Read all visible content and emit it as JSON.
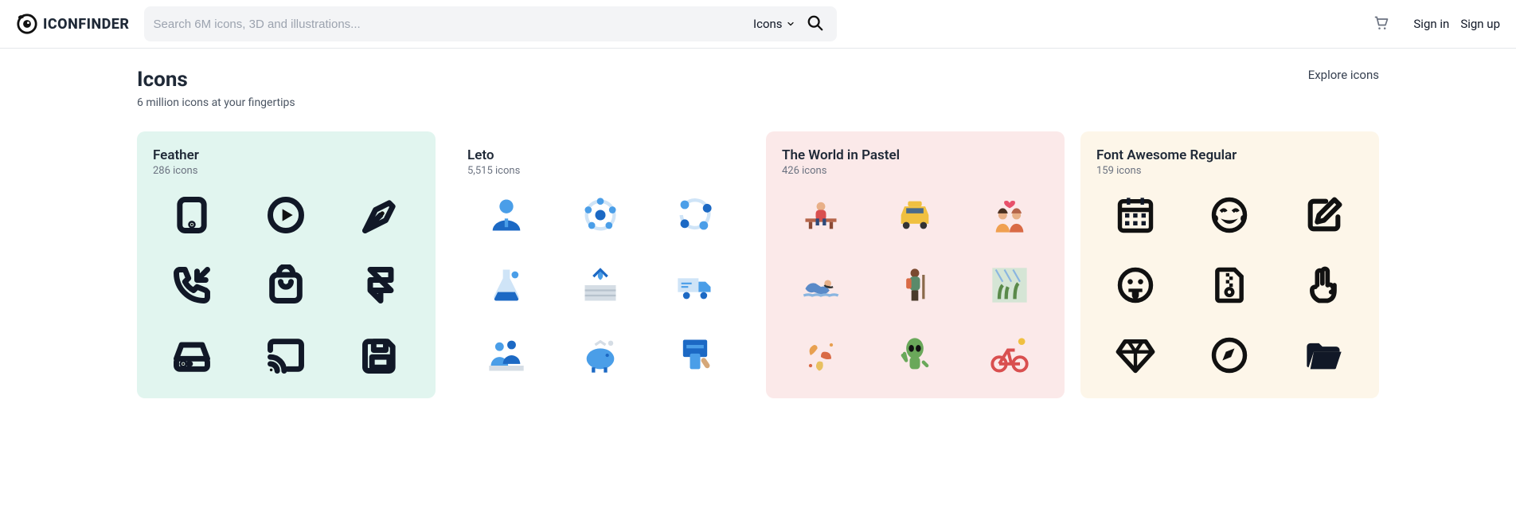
{
  "header": {
    "brand": "ICONFINDER",
    "search_placeholder": "Search 6M icons, 3D and illustrations...",
    "search_type_label": "Icons",
    "sign_in": "Sign in",
    "sign_up": "Sign up"
  },
  "section": {
    "title": "Icons",
    "subtitle": "6 million icons at your fingertips",
    "explore": "Explore icons"
  },
  "cards": {
    "feather": {
      "title": "Feather",
      "count": "286 icons"
    },
    "leto": {
      "title": "Leto",
      "count": "5,515 icons"
    },
    "pastel": {
      "title": "The World in Pastel",
      "count": "426 icons"
    },
    "fa": {
      "title": "Font Awesome Regular",
      "count": "159 icons"
    }
  }
}
